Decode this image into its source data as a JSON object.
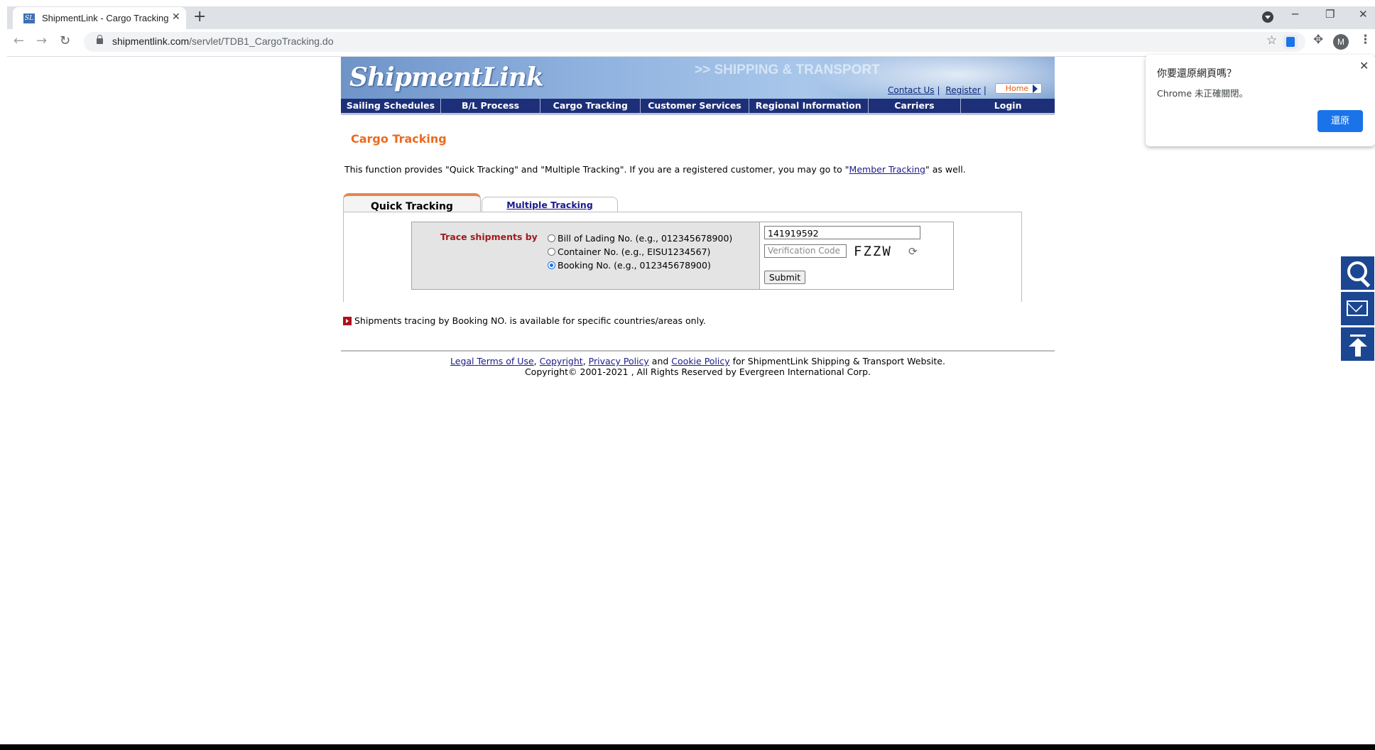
{
  "browser": {
    "tab_title": "ShipmentLink - Cargo Tracking",
    "tab_favicon": "SL",
    "tab_close": "✕",
    "new_tab": "+",
    "url_host": "shipmentlink.com",
    "url_path": "/servlet/TDB1_CargoTracking.do",
    "avatar_letter": "M",
    "back_icon": "←",
    "forward_icon": "→",
    "reload_icon": "↻",
    "star_icon": "☆",
    "puzzle_icon": "✥",
    "menu_icon": "⋮",
    "minimize_icon": "─",
    "restore_icon": "❐",
    "close_icon": "✕"
  },
  "site": {
    "logo": "ShipmentLink",
    "tagline": ">> SHIPPING & TRANSPORT",
    "top_links": {
      "contact": "Contact Us",
      "register": "Register",
      "home": "Home",
      "sep": "|"
    },
    "nav": [
      "Sailing Schedules",
      "B/L Process",
      "Cargo Tracking",
      "Customer Services",
      "Regional Information",
      "Carriers",
      "Login"
    ],
    "page_title": "Cargo Tracking",
    "intro_prefix": "This function provides \"Quick Tracking\" and \"Multiple Tracking\". If you are a registered customer, you may go to \"",
    "intro_link": "Member Tracking",
    "intro_suffix": "\" as well.",
    "tabs": {
      "active": "Quick Tracking",
      "inactive": "Multiple Tracking"
    },
    "form": {
      "trace_label": "Trace shipments by",
      "options": [
        {
          "label": "Bill of Lading No. (e.g., 012345678900)",
          "checked": false
        },
        {
          "label": "Container No. (e.g., EISU1234567)",
          "checked": false
        },
        {
          "label": "Booking No. (e.g., 012345678900)",
          "checked": true
        }
      ],
      "number_value": "141919592",
      "verify_placeholder": "Verification Code",
      "captcha": "FZZW",
      "refresh_icon": "⟳",
      "submit": "Submit"
    },
    "note": "Shipments tracing by Booking NO. is available for specific countries/areas only.",
    "footer": {
      "links": [
        "Legal Terms of Use",
        "Copyright",
        "Privacy Policy",
        "Cookie Policy"
      ],
      "sep1": ", ",
      "sep2": ", ",
      "and": " and ",
      "suffix": " for ShipmentLink Shipping & Transport Website.",
      "copyright": "Copyright© 2001-2021 , All Rights Reserved by Evergreen International Corp."
    }
  },
  "restore_popup": {
    "title": "你要還原網頁嗎？",
    "message": "Chrome 未正確關閉。",
    "button": "還原",
    "close": "✕"
  },
  "colors": {
    "accent_orange": "#ec6a1b",
    "nav_blue": "#1c2f78",
    "side_button_blue": "#1b4691",
    "chrome_blue": "#1a73e8"
  },
  "icons": [
    "search-icon",
    "mail-icon",
    "back-to-top-icon"
  ]
}
